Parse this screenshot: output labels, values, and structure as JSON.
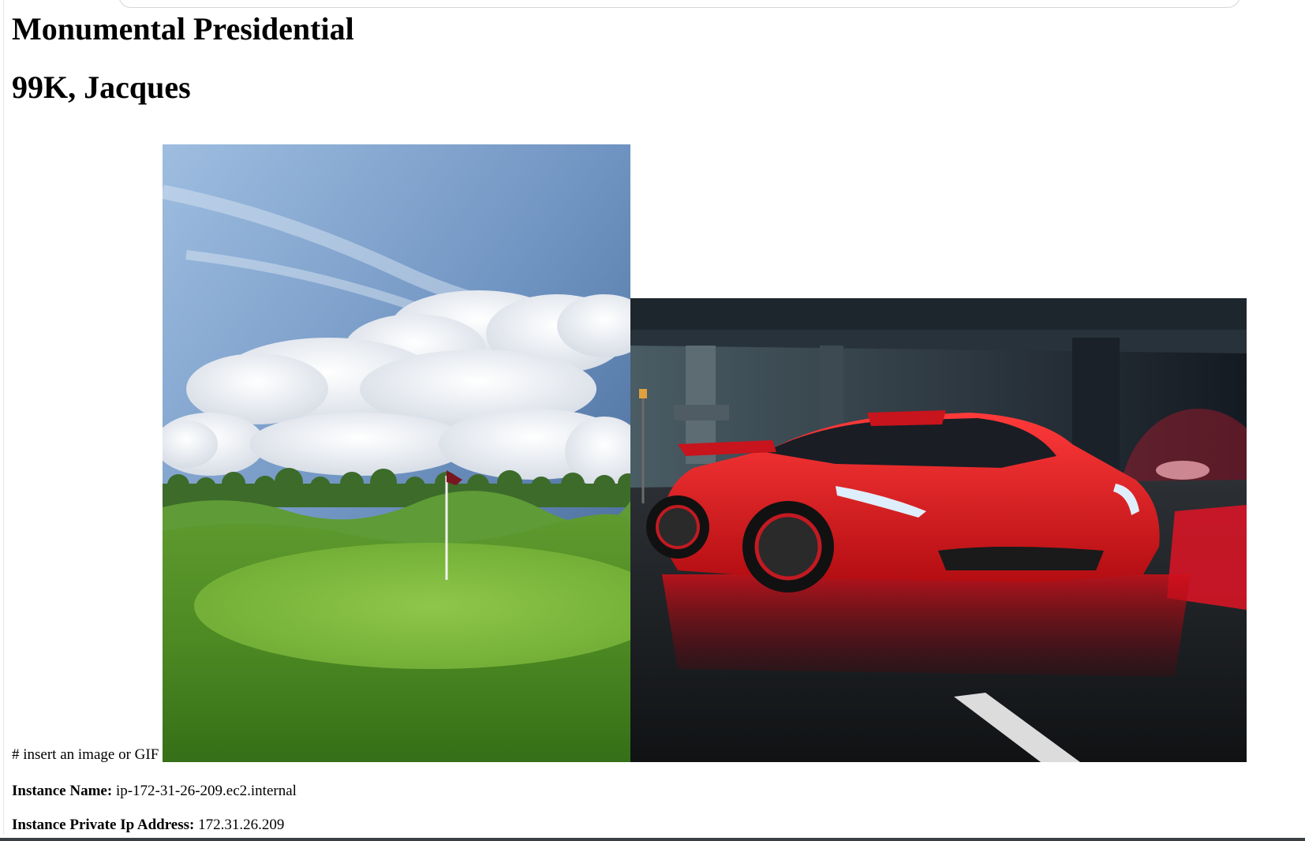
{
  "page": {
    "title": "Monumental Presidential",
    "subtitle": "99K, Jacques"
  },
  "images": {
    "caption": "# insert an image or GIF",
    "first": "golf-course-photo",
    "second": "red-sports-car-photo"
  },
  "instance": {
    "name_label": "Instance Name:",
    "name_value": "ip-172-31-26-209.ec2.internal",
    "ip_label": "Instance Private Ip Address:",
    "ip_value": "172.31.26.209"
  }
}
